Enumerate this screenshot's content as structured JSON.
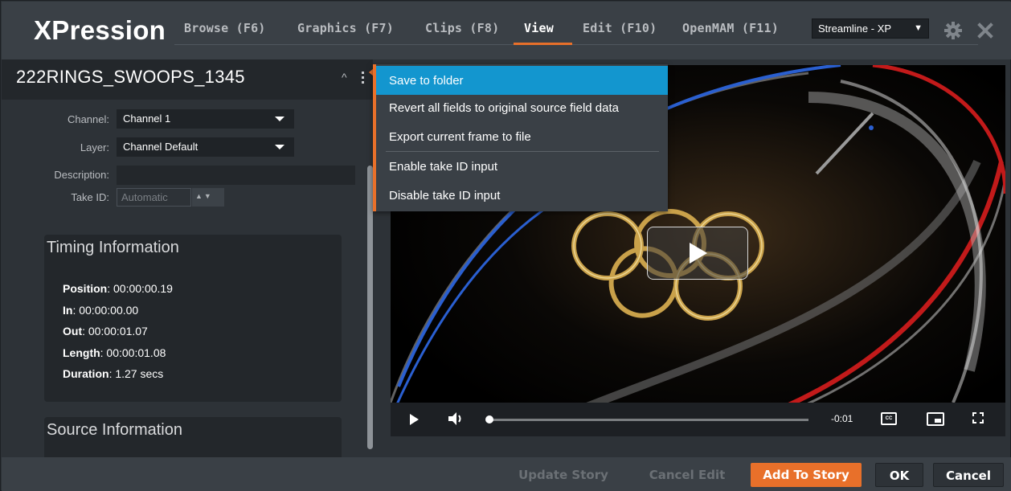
{
  "header": {
    "logo": "XPression",
    "tabs": [
      {
        "label": "Browse (F6)"
      },
      {
        "label": "Graphics (F7)"
      },
      {
        "label": "Clips (F8)"
      },
      {
        "label": "View"
      },
      {
        "label": "Edit (F10)"
      },
      {
        "label": "OpenMAM (F11)"
      }
    ],
    "active_tab": "View",
    "profile_value": "Streamline - XP",
    "accent_color": "#e8702a",
    "icons": [
      "gear-icon",
      "close-icon"
    ]
  },
  "clip": {
    "title": "222RINGS_SWOOPS_1345"
  },
  "form": {
    "channel_label": "Channel:",
    "channel_value": "Channel 1",
    "layer_label": "Layer:",
    "layer_value": "Channel Default",
    "description_label": "Description:",
    "description_value": "",
    "takeid_label": "Take ID:",
    "takeid_placeholder": "Automatic"
  },
  "timing": {
    "title": "Timing Information",
    "position_label": "Position",
    "position_value": ": 00:00:00.19",
    "in_label": "In",
    "in_value": ": 00:00:00.00",
    "out_label": "Out",
    "out_value": ": 00:00:01.07",
    "length_label": "Length",
    "length_value": ": 00:00:01.08",
    "duration_label": "Duration",
    "duration_value": ": 1.27 secs"
  },
  "source": {
    "title": "Source Information"
  },
  "player": {
    "time_remaining": "-0:01",
    "progress": 0.0,
    "cc_label": "CC"
  },
  "menu": {
    "items": [
      {
        "label": "Save to folder"
      },
      {
        "label": "Revert all fields to original source field data"
      },
      {
        "label": "Export current frame to file"
      },
      {
        "label": "Enable take ID input"
      },
      {
        "label": "Disable take ID input"
      }
    ],
    "highlighted": "Save to folder",
    "highlight_color": "#1396cf"
  },
  "footer": {
    "update_story": "Update Story",
    "cancel_edit": "Cancel Edit",
    "add_to_story": "Add To Story",
    "ok": "OK",
    "cancel": "Cancel"
  }
}
